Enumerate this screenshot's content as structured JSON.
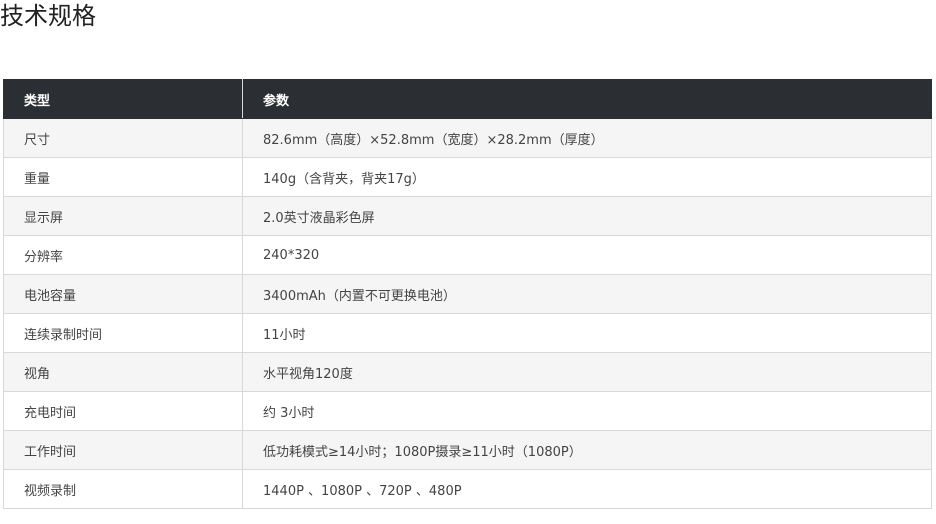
{
  "page": {
    "title": "技术规格"
  },
  "table": {
    "headers": [
      "类型",
      "参数"
    ],
    "rows": [
      {
        "type": "尺寸",
        "value": "82.6mm（高度）×52.8mm（宽度）×28.2mm（厚度）"
      },
      {
        "type": "重量",
        "value": "140g（含背夹，背夹17g）"
      },
      {
        "type": "显示屏",
        "value": "2.0英寸液晶彩色屏"
      },
      {
        "type": "分辨率",
        "value": "240*320"
      },
      {
        "type": "电池容量",
        "value": "3400mAh（内置不可更换电池）"
      },
      {
        "type": "连续录制时间",
        "value": "11小时"
      },
      {
        "type": "视角",
        "value": "水平视角120度"
      },
      {
        "type": "充电时间",
        "value": "约 3小时"
      },
      {
        "type": "工作时间",
        "value": "低功耗模式≥14小时；1080P摄录≥11小时（1080P）"
      },
      {
        "type": "视频录制",
        "value": "1440P 、1080P 、720P 、480P"
      }
    ]
  },
  "colors": {
    "header_bg": "#2b2e33",
    "header_text": "#ffffff",
    "row_alt_bg": "#f5f5f5",
    "border": "#d8d8d8"
  }
}
